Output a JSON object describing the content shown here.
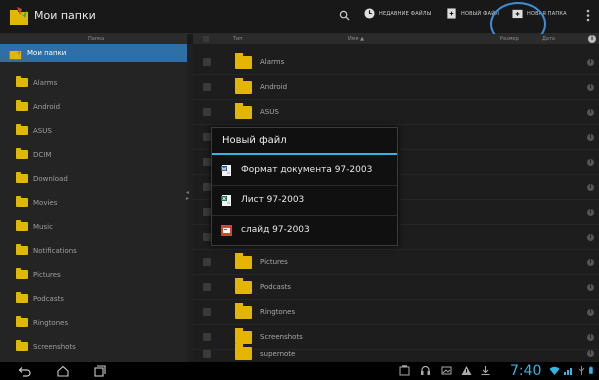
{
  "topbar": {
    "title": "Мои папки",
    "recent_files": "НЕДАВНИЕ ФАЙЛЫ",
    "new_file": "НОВЫЙ ФАЙЛ",
    "new_folder": "НОВАЯ ПАПКА"
  },
  "left_header": "Папка",
  "right_header": {
    "type": "Тип",
    "name": "Имя ▲",
    "size": "Размер",
    "date": "Дата"
  },
  "tree": {
    "root": "Мои папки",
    "items": [
      "Alarms",
      "Android",
      "ASUS",
      "DCIM",
      "Download",
      "Movies",
      "Music",
      "Notifications",
      "Pictures",
      "Podcasts",
      "Ringtones",
      "Screenshots"
    ]
  },
  "files": [
    "Alarms",
    "Android",
    "ASUS",
    "",
    "",
    "",
    "",
    "",
    "Pictures",
    "Podcasts",
    "Ringtones",
    "Screenshots",
    "supernote"
  ],
  "dialog": {
    "title": "Новый файл",
    "items": [
      {
        "label": "Формат документа 97-2003",
        "icon": "word-doc-icon"
      },
      {
        "label": "Лист 97-2003",
        "icon": "excel-sheet-icon"
      },
      {
        "label": "слайд 97-2003",
        "icon": "powerpoint-slide-icon"
      }
    ]
  },
  "statusbar": {
    "time": "7:40"
  },
  "colors": {
    "accent": "#33b5e5",
    "folder": "#e4b500",
    "selected": "#2d6fa6"
  }
}
